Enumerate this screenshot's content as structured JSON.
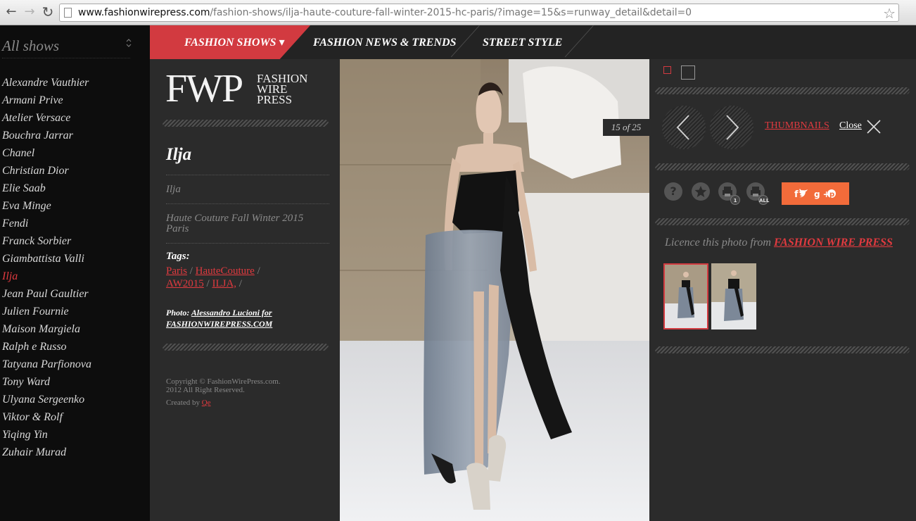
{
  "browser": {
    "url_host": "www.fashionwirepress.com",
    "url_path": "/fashion-shows/ilja-haute-couture-fall-winter-2015-hc-paris/?image=15&s=runway_detail&detail=0",
    "back": "←",
    "forward": "→",
    "reload": "↻",
    "star": "☆"
  },
  "sidebar": {
    "select_label": "All shows",
    "select_arrow": "⌃⌄",
    "designers": [
      "Alexandre Vauthier",
      "Armani Prive",
      "Atelier Versace",
      "Bouchra Jarrar",
      "Chanel",
      "Christian Dior",
      "Elie Saab",
      "Eva Minge",
      "Fendi",
      "Franck Sorbier",
      "Giambattista Valli",
      "Ilja",
      "Jean Paul Gaultier",
      "Julien Fournie",
      "Maison Margiela",
      "Ralph e Russo",
      "Tatyana Parfionova",
      "Tony Ward",
      "Ulyana Sergeenko",
      "Viktor & Rolf",
      "Yiqing Yin",
      "Zuhair Murad"
    ],
    "active_designer": "Ilja"
  },
  "topnav": {
    "items": [
      "FASHION SHOWS ▾",
      "FASHION NEWS & TRENDS",
      "STREET STYLE"
    ]
  },
  "info": {
    "logo_mark": "FWP",
    "logo_line1": "FASHION",
    "logo_line2": "WIRE",
    "logo_line3": "PRESS",
    "title": "Ilja",
    "designer": "Ilja",
    "season_line1": "Haute Couture Fall Winter 2015",
    "season_line2": "Paris",
    "tags_label": "Tags:",
    "tags": [
      "Paris",
      "HauteCouture",
      "AW2015",
      "ILJA,"
    ],
    "tag_separator": "/",
    "photo_label": "Photo:",
    "photo_credit": "Alessandro Lucioni for",
    "photo_credit2": "FASHIONWIREPRESS.COM",
    "copyright_line1": "Copyright © FashionWirePress.com.",
    "copyright_line2": "2012 All Right Reserved.",
    "created_by": "Created by",
    "created_by_link": "Qe"
  },
  "viewer": {
    "counter": "15 of 25",
    "thumbnails_link": "THUMBNAILS",
    "close_link": "Close",
    "print_one_badge": "1",
    "print_all_badge": "ALL",
    "help_glyph": "?",
    "share_glyphs": "f  g+ ",
    "licence_text": "Licence this photo from",
    "licence_link": "FASHION WIRE PRESS"
  },
  "colors": {
    "accent": "#d23a40",
    "share": "#f26b3a",
    "panel": "#2b2b2b",
    "sidebar": "#0d0d0d"
  }
}
